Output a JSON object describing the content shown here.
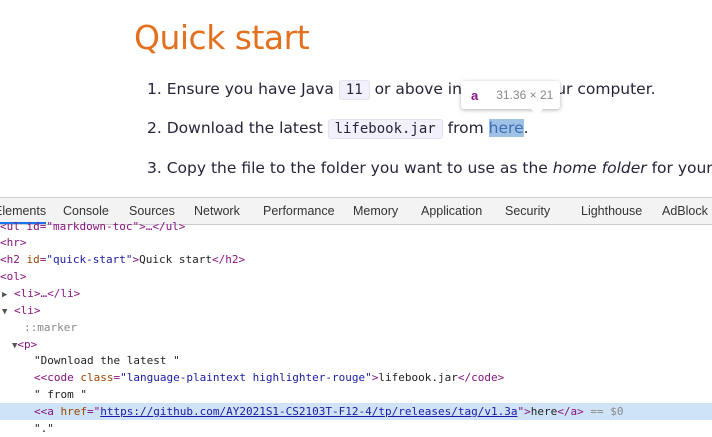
{
  "page": {
    "heading": "Quick start",
    "items": [
      {
        "number": "1.",
        "before": "Ensure you have Java ",
        "code": "11",
        "after": " or above installed in your computer."
      },
      {
        "number": "2.",
        "before": "Download the latest ",
        "code": "lifebook.jar",
        "mid": " from ",
        "link": "here",
        "after": "."
      },
      {
        "number": "3.",
        "before": "Copy the file to the folder you want to use as the ",
        "em": "home folder",
        "after": " for your Lifebook"
      }
    ],
    "tooltip": {
      "tag": "a",
      "size": "31.36 × 21"
    }
  },
  "devtools": {
    "tabs": [
      "Elements",
      "Console",
      "Sources",
      "Network",
      "Performance",
      "Memory",
      "Application",
      "Security",
      "Lighthouse",
      "AdBlock"
    ],
    "active_tab": "Elements",
    "dom": {
      "l0": "<ul id=\"markdown-toc\">…</ul>",
      "l1": "<hr>",
      "l2_open": "<h2 ",
      "l2_attr": "id",
      "l2_val": "\"quick-start\"",
      "l2_text": "Quick start",
      "l2_close": "</h2>",
      "l3": "<ol>",
      "l4": "<li>…</li>",
      "l5": "<li>",
      "l6": "::marker",
      "l7": "<p>",
      "l8": "\"Download the latest \"",
      "l9_open": "<code ",
      "l9_attr": "class",
      "l9_val": "\"language-plaintext highlighter-rouge\"",
      "l9_text": "lifebook.jar",
      "l9_close": "</code>",
      "l10": "\" from \"",
      "l11_open": "<a ",
      "l11_attr": "href",
      "l11_url": "https://github.com/AY2021S1-CS2103T-F12-4/tp/releases/tag/v1.3a",
      "l11_text": "here",
      "l11_close": "</a>",
      "l11_marker": "== $0",
      "l12": "\".\""
    }
  }
}
